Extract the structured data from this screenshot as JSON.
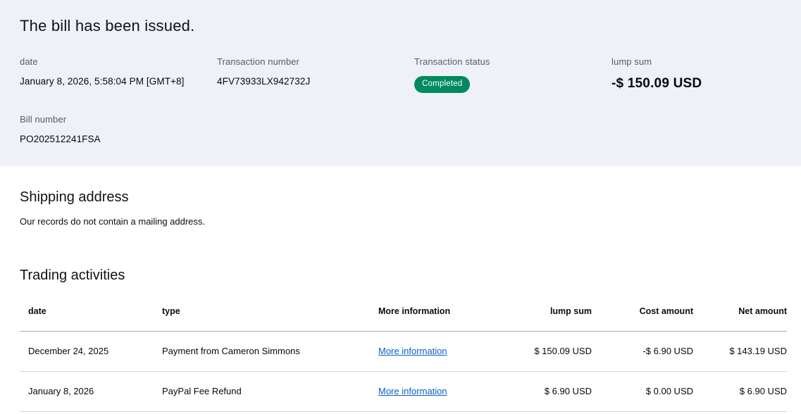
{
  "hero": {
    "title": "The bill has been issued.",
    "date_label": "date",
    "date_value": "January 8, 2026, 5:58:04 PM [GMT+8]",
    "txn_label": "Transaction number",
    "txn_value": "4FV73933LX942732J",
    "status_label": "Transaction status",
    "status_value": "Completed",
    "lump_label": "lump sum",
    "lump_value": "-$ 150.09 USD",
    "bill_label": "Bill number",
    "bill_value": "PO202512241FSA"
  },
  "shipping": {
    "title": "Shipping address",
    "message": "Our records do not contain a mailing address."
  },
  "trading": {
    "title": "Trading activities",
    "headers": [
      "date",
      "type",
      "More information",
      "lump sum",
      "Cost amount",
      "Net amount"
    ],
    "rows": [
      {
        "date": "December 24, 2025",
        "type": "Payment from Cameron Simmons",
        "more_info": "More information",
        "lump_sum": "$ 150.09 USD",
        "cost": "-$ 6.90 USD",
        "net": "$ 143.19 USD"
      },
      {
        "date": "January 8, 2026",
        "type": "PayPal Fee Refund",
        "more_info": "More information",
        "lump_sum": "$ 6.90 USD",
        "cost": "$ 0.00 USD",
        "net": "$ 6.90 USD"
      }
    ]
  },
  "colors": {
    "hero_bg": "#eef1f7",
    "badge": "#008a5e",
    "link": "#0b5dc7",
    "label": "#545d69"
  }
}
